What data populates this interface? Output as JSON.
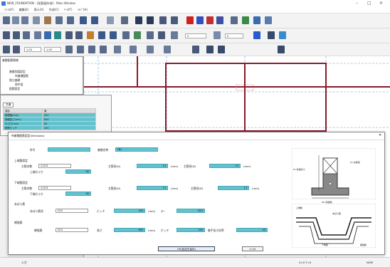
{
  "titlebar": {
    "title": "NEW_FOUNDATION - [配筋図作成] - Main Window",
    "min": "–",
    "max": "□",
    "close": "✕"
  },
  "menubar": {
    "items": [
      "ﾌｧｲﾙ(F)",
      "編集(E)",
      "表示(V)",
      "作成(C)",
      "ﾂｰﾙ(T)",
      "ﾍﾙﾌﾟ(H)"
    ]
  },
  "toolbar3": {
    "combo1": "1.00",
    "combo2": "1.00",
    "combo3": "0",
    "combo4": "0"
  },
  "tree": {
    "header": "基礎配筋情報",
    "items": [
      "基礎伏図設定",
      "布基礎配筋",
      "独立基礎",
      "地中梁",
      "配筋設定"
    ]
  },
  "props": {
    "tab": "共通",
    "col1": "項目",
    "col2": "値",
    "rows": [
      [
        "基礎幅(mm)",
        "450"
      ],
      [
        "基礎高さ(mm)",
        "600"
      ],
      [
        "かぶり(mm)",
        "60"
      ],
      [
        "配筋ピッチ",
        "200"
      ]
    ]
  },
  "dialog": {
    "title": "布基礎配筋設定(Windows)",
    "sym_label": "符号",
    "sym_val": "",
    "name_label": "基礎名称",
    "name_val": "FB1",
    "sec1": "上端筋設定",
    "s1r1_label": "主筋本数",
    "s1r1_sel": "2-D13",
    "s1r1_mid_label": "主筋径(D)",
    "s1r1_mid_val": "13",
    "s1r1_unit": "(mm)",
    "s1r1_r_label": "主筋径(D)",
    "s1r1_r_val": "13",
    "s1r1_r_unit": "(mm)",
    "s1r2_label": "上端かぶり",
    "s1r2_val": "60",
    "sec2": "下端筋設定",
    "s2r1_label": "主筋本数",
    "s2r1_sel": "2-D13",
    "s2r1_mid_label": "主筋径(D)",
    "s2r1_mid_val": "13",
    "s2r1_unit": "(mm)",
    "s2r1_r_label": "主筋径(D)",
    "s2r1_r_val": "13",
    "s2r1_r_unit": "(mm)",
    "s2r2_label": "下端かぶり",
    "s2r2_val": "60",
    "sec3": "あばら筋",
    "s3_label": "あばら筋径",
    "s3_sel": "D10",
    "s3_mid_label": "ピッチ",
    "s3_mid_val": "200",
    "s3_unit": "(mm)",
    "s3_r_label": "ｽﾃｰ",
    "s3_r_val": "D10",
    "sec4": "補強筋",
    "s4_label": "補強筋",
    "s4_sel": "D13",
    "s4_mid_label": "長さ",
    "s4_mid_val": "600",
    "s4_unit": "(mm)",
    "s4_r_label": "ピッチ",
    "s4_r_val": "200",
    "s4_r2_label": "継手長さ倍率",
    "s4_r2_val": "40",
    "ok": "OK(設定を保存)",
    "cancel": "ｷｬﾝｾﾙ",
    "diag1_label": "D=主筋径",
    "diag1_label2": "H=基礎高さ",
    "diag1_label3": "W=基礎幅",
    "diag2_label1": "上端筋",
    "diag2_label2": "あばら筋",
    "diag2_label3": "下端筋",
    "diag2_label4": "補強筋"
  },
  "status": {
    "left": "入力",
    "mid": "X=0 Y=0",
    "right": "NUM"
  },
  "colors": {
    "accent": "#62c3cf",
    "wall": "#8b1a2a",
    "grid": "#5aa0d8"
  }
}
